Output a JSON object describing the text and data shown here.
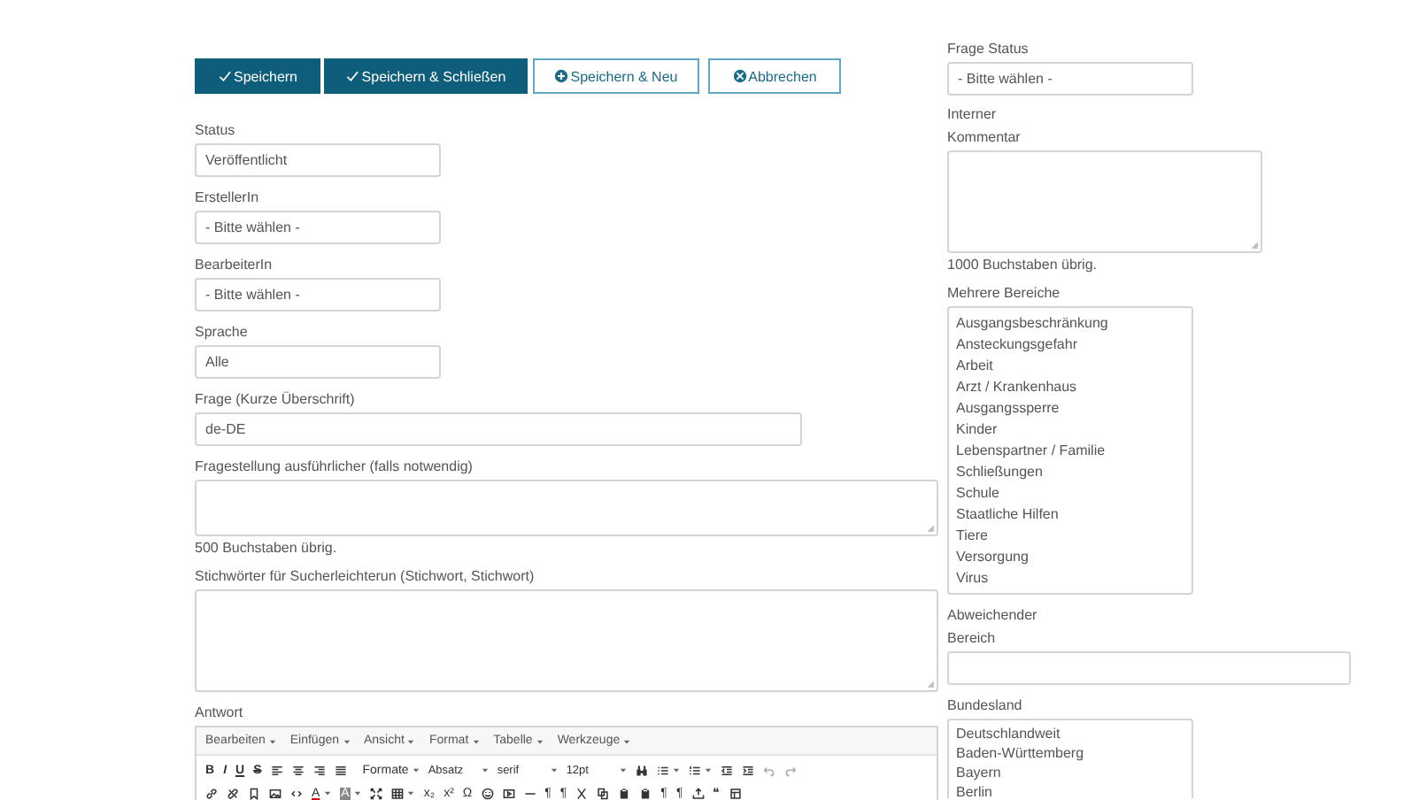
{
  "actions": [
    {
      "label": "Speichern",
      "kind": "save"
    },
    {
      "label": "Speichern & Schließen",
      "kind": "save"
    },
    {
      "label": "Speichern & Neu",
      "kind": "add"
    },
    {
      "label": "Abbrechen",
      "kind": "cancel"
    }
  ],
  "left_fields": [
    {
      "kind": "select",
      "label": "Status",
      "value": "Veröffentlicht"
    },
    {
      "kind": "select",
      "label": "ErstellerIn",
      "value": "- Bitte wählen -"
    },
    {
      "kind": "select",
      "label": "BearbeiterIn",
      "value": "- Bitte wählen -"
    },
    {
      "kind": "select",
      "label": "Sprache",
      "value": "Alle"
    },
    {
      "kind": "text",
      "label": "Frage (Kurze Überschrift)",
      "value": "de-DE"
    },
    {
      "kind": "textarea",
      "label": "Fragestellung ausführlicher (falls notwendig)",
      "counter": "500 Buchstaben übrig."
    },
    {
      "kind": "textarea-tall",
      "label": "Stichwörter für Sucherleichterun (Stichwort, Stichwort)"
    }
  ],
  "editor": {
    "label": "Antwort",
    "menus": [
      "Bearbeiten",
      "Einfügen",
      "Ansicht",
      "Format",
      "Tabelle",
      "Werkzeuge"
    ],
    "toolbar_top": [
      {
        "kind": "bold",
        "text": "B"
      },
      {
        "kind": "italic",
        "text": "I"
      },
      {
        "kind": "underline",
        "text": "U"
      },
      {
        "kind": "strike",
        "text": "S"
      },
      {
        "kind": "alignleft"
      },
      {
        "kind": "aligncenter"
      },
      {
        "kind": "alignright"
      },
      {
        "kind": "justify"
      },
      {
        "kind": "menu",
        "text": "Formate"
      },
      {
        "kind": "select",
        "text": "Absatz"
      },
      {
        "kind": "select",
        "text": "serif"
      },
      {
        "kind": "select",
        "text": "12pt"
      },
      {
        "kind": "binoculars"
      },
      {
        "kind": "bullets",
        "caret": true
      },
      {
        "kind": "numbers",
        "caret": true
      },
      {
        "kind": "outdent"
      },
      {
        "kind": "indent"
      },
      {
        "kind": "undo",
        "disabled": true
      },
      {
        "kind": "redo",
        "disabled": true
      }
    ],
    "toolbar_bottom": [
      {
        "kind": "link"
      },
      {
        "kind": "unlink"
      },
      {
        "kind": "bookmark"
      },
      {
        "kind": "image"
      },
      {
        "kind": "code"
      },
      {
        "kind": "color",
        "text": "A",
        "caret": true
      },
      {
        "kind": "highlight",
        "text": "A",
        "caret": true
      },
      {
        "kind": "fullscreen"
      },
      {
        "kind": "table",
        "caret": true
      },
      {
        "kind": "plain",
        "text": "x₂"
      },
      {
        "kind": "plain",
        "text": "x²"
      },
      {
        "kind": "plain",
        "text": "Ω"
      },
      {
        "kind": "smiley"
      },
      {
        "kind": "media"
      },
      {
        "kind": "rule"
      },
      {
        "kind": "plain",
        "text": "¶"
      },
      {
        "kind": "plain",
        "text": "¶"
      },
      {
        "kind": "scissors"
      },
      {
        "kind": "copy"
      },
      {
        "kind": "paste"
      },
      {
        "kind": "paste"
      },
      {
        "kind": "plain",
        "text": "¶"
      },
      {
        "kind": "plain",
        "text": "¶"
      },
      {
        "kind": "upload"
      },
      {
        "kind": "plain",
        "text": "❝"
      },
      {
        "kind": "template"
      }
    ]
  },
  "right_fields": [
    {
      "kind": "select",
      "label": [
        "Frage Status"
      ],
      "value": "- Bitte wählen -"
    },
    {
      "kind": "textarea",
      "label": [
        "Interner",
        "Kommentar"
      ],
      "counter": "1000 Buchstaben übrig."
    },
    {
      "kind": "listbox",
      "label": [
        "Mehrere Bereiche"
      ],
      "options": [
        "Ausgangsbeschränkung",
        "Ansteckungsgefahr",
        "Arbeit",
        "Arzt / Krankenhaus",
        "Ausgangssperre",
        "Kinder",
        "Lebenspartner / Familie",
        "Schließungen",
        "Schule",
        "Staatliche Hilfen",
        "Tiere",
        "Versorgung",
        "Virus"
      ]
    },
    {
      "kind": "text",
      "label": [
        "Abweichender",
        "Bereich"
      ]
    },
    {
      "kind": "listbox-short",
      "label": [
        "Bundesland"
      ],
      "options": [
        "Deutschlandweit",
        "Baden-Württemberg",
        "Bayern",
        "Berlin"
      ]
    }
  ]
}
